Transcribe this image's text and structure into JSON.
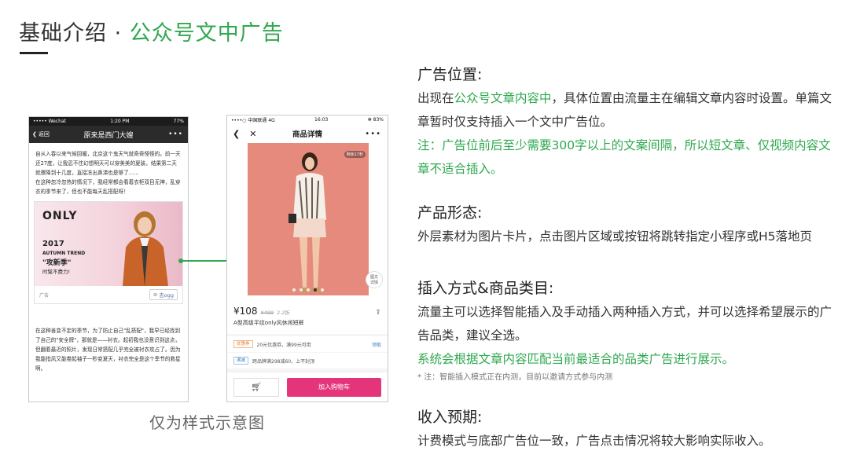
{
  "header": {
    "title_main": "基础介绍",
    "title_sep": "·",
    "title_sub": "公众号文中广告"
  },
  "wechat_phone": {
    "status_left": "••••• Wechat",
    "status_time": "1:20 PM",
    "status_battery": "77%",
    "back_label": "返回",
    "nav_title": "原来是西门大嫂",
    "more_icon": "•••",
    "para1": "自从入春以来气候回暖，北京这个鬼天气就奇奇怪怪的。前一天还27度，让我忍不住幻想明天可以穿美美的夏装，结果第二天就骤降到十几度，直接冻出鼻涕也是够了……",
    "para2": "在这种忽冷忽热的情况下，我经常都会看着衣柜双目无神，乱穿衣的季节来了，但也不能每天乱搭配呀！",
    "ad": {
      "brand": "ONLY",
      "year": "2017",
      "trend": "AUTUMN TREND",
      "slogan": "\"攻新季\"",
      "subline": "时髦不费力!",
      "label": "广告",
      "button": "去ogg"
    },
    "para3": "在这种善变不定的季节，为了防止自己\"乱搭配\"，我早已经找到了自己的\"安全牌\"，那就是——衬衣。起初我也没意识到这点，但翻着最近的照片，发现日常搭配几乎完全被衬衣攻占了。因为我能指风又能卷起袖子一秒变夏天，衬衣完全是这个季节的救星啊。"
  },
  "product_phone": {
    "status_left": "••••○ 中国联通  4G",
    "status_time": "16:03",
    "status_right": "✻ 83%",
    "nav_title": "商品详情",
    "more_icon": "•••",
    "photo_badge": "剩余17秒",
    "detail_tag_1": "图文",
    "detail_tag_2": "详情",
    "price": "¥108",
    "old_price": "¥499",
    "discount": "2.2折",
    "share_icon": "⇪",
    "product_name": "A型高级平纹only风休闲短裤",
    "coupon1_tag": "优惠券",
    "coupon1_text": "20元优惠券，满99元可用",
    "coupon1_action": "领取",
    "coupon2_tag": "满减",
    "coupon2_text": "跨品牌满298减60，上不封顶",
    "add_to_cart": "加入购物车"
  },
  "caption": "仅为样式示意图",
  "sections": {
    "position": {
      "heading": "广告位置:",
      "line1_a": "出现在",
      "line1_b": "公众号文章内容中",
      "line1_c": "，具体位置由流量主在编辑文章内容时设置。单篇文章暂时仅支持插入一个文中广告位。",
      "note": "注：广告位前后至少需要300字以上的文案间隔，所以短文章、仅视频内容文章不适合插入。"
    },
    "form": {
      "heading": "产品形态:",
      "text": "外层素材为图片卡片，点击图片区域或按钮将跳转指定小程序或H5落地页"
    },
    "insert": {
      "heading": "插入方式&商品类目:",
      "text": "流量主可以选择智能插入及手动插入两种插入方式，并可以选择希望展示的广告品类，建议全选。",
      "green_text": "系统会根据文章内容匹配当前最适合的品类广告进行展示。",
      "small_note": "* 注：智能插入模式正在内测，目前以邀请方式参与内测"
    },
    "income": {
      "heading": "收入预期:",
      "text": "计费模式与底部广告位一致，广告点击情况将较大影响实际收入。"
    }
  },
  "colors": {
    "accent_green": "#2fa84f",
    "cart_pink": "#e4357a",
    "wechat_bar": "#2b2b2b",
    "photo_bg": "#e58a7c"
  }
}
